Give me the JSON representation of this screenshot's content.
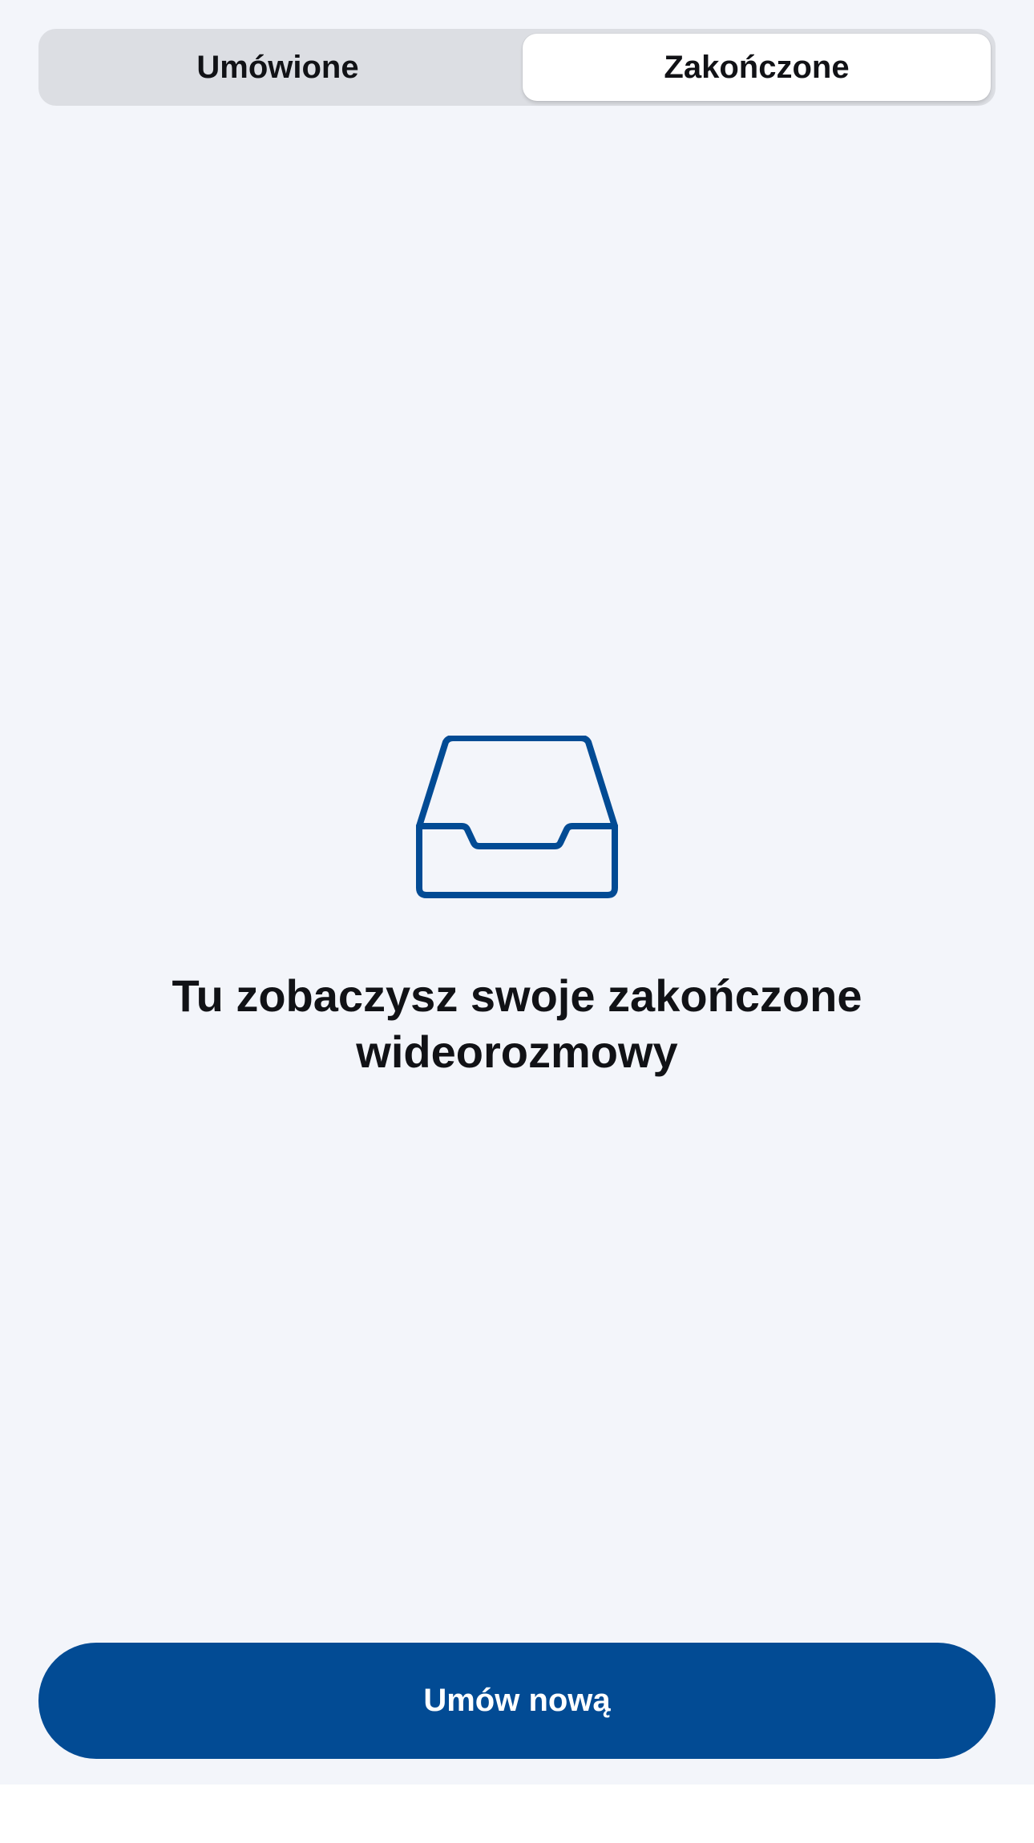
{
  "tabs": {
    "scheduled_label": "Umówione",
    "completed_label": "Zakończone",
    "selected": "Zakończone"
  },
  "empty_state": {
    "icon": "inbox-tray-icon",
    "title": "Tu zobaczysz swoje zakończone wideorozmowy"
  },
  "actions": {
    "new_appointment_label": "Umów nową"
  },
  "colors": {
    "background": "#f3f5fa",
    "segmented_track": "#dcdee3",
    "selected_segment": "#ffffff",
    "accent": "#024b94",
    "text": "#111216"
  }
}
